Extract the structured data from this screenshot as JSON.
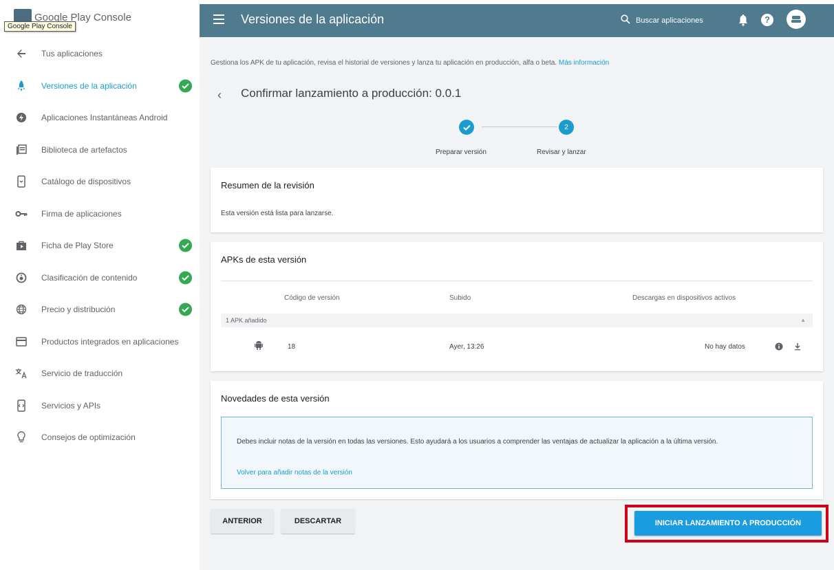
{
  "app": {
    "logo_text": "Google Play Console",
    "logo_tooltip": "Google Play Console"
  },
  "sidebar": {
    "items": [
      {
        "label": "Tus aplicaciones",
        "icon": "back-arrow-icon",
        "active": false,
        "complete": false
      },
      {
        "label": "Versiones de la aplicación",
        "icon": "rocket-icon",
        "active": true,
        "complete": true
      },
      {
        "label": "Aplicaciones Instantáneas Android",
        "icon": "bolt-icon",
        "active": false,
        "complete": false
      },
      {
        "label": "Biblioteca de artefactos",
        "icon": "library-icon",
        "active": false,
        "complete": false
      },
      {
        "label": "Catálogo de dispositivos",
        "icon": "device-icon",
        "active": false,
        "complete": false
      },
      {
        "label": "Firma de aplicaciones",
        "icon": "key-icon",
        "active": false,
        "complete": false
      },
      {
        "label": "Ficha de Play Store",
        "icon": "store-icon",
        "active": false,
        "complete": true
      },
      {
        "label": "Clasificación de contenido",
        "icon": "rating-icon",
        "active": false,
        "complete": true
      },
      {
        "label": "Precio y distribución",
        "icon": "globe-icon",
        "active": false,
        "complete": true
      },
      {
        "label": "Productos integrados en aplicaciones",
        "icon": "card-icon",
        "active": false,
        "complete": false
      },
      {
        "label": "Servicio de traducción",
        "icon": "translate-icon",
        "active": false,
        "complete": false
      },
      {
        "label": "Servicios y APIs",
        "icon": "api-icon",
        "active": false,
        "complete": false
      },
      {
        "label": "Consejos de optimización",
        "icon": "lightbulb-icon",
        "active": false,
        "complete": false
      }
    ]
  },
  "header": {
    "title": "Versiones de la aplicación",
    "search_label": "Buscar aplicaciones"
  },
  "main": {
    "intro_text": "Gestiona los APK de tu aplicación, revisa el historial de versiones y lanza tu aplicación en producción, alfa o beta.",
    "intro_link": "Más información",
    "page_title": "Confirmar lanzamiento a producción: 0.0.1",
    "stepper": {
      "steps": [
        {
          "label": "Preparar versión",
          "number": "1",
          "done": true
        },
        {
          "label": "Revisar y lanzar",
          "number": "2",
          "done": false
        }
      ]
    },
    "review": {
      "title": "Resumen de la revisión",
      "text": "Esta versión está lista para lanzarse."
    },
    "apks": {
      "title": "APKs de esta versión",
      "columns": [
        "Código de versión",
        "Subido",
        "Descargas en dispositivos activos"
      ],
      "group_label": "1 APK añadido",
      "rows": [
        {
          "version_code": "18",
          "uploaded": "Ayer, 13:26",
          "downloads": "No hay datos"
        }
      ]
    },
    "notes": {
      "title": "Novedades de esta versión",
      "message": "Debes incluir notas de la versión en todas las versiones. Esto ayudará a los usuarios a comprender las ventajas de actualizar la aplicación a la última versión.",
      "link": "Volver para añadir notas de la versión"
    },
    "buttons": {
      "previous": "ANTERIOR",
      "discard": "DESCARTAR",
      "start_rollout": "INICIAR LANZAMIENTO A PRODUCCIÓN"
    }
  },
  "colors": {
    "topbar": "#507a8d",
    "accent": "#1a9ccf",
    "success": "#34a853",
    "highlight": "#d0021b"
  }
}
